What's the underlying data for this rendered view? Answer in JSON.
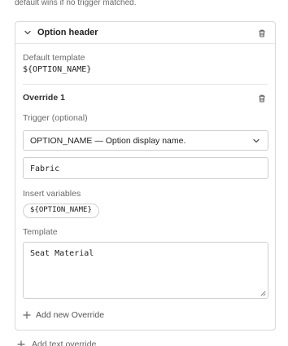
{
  "note": "default wins if no trigger matched.",
  "panel": {
    "title": "Option header",
    "default_label": "Default template",
    "default_value": "${OPTION_NAME}",
    "override": {
      "title": "Override 1",
      "trigger_label": "Trigger (optional)",
      "trigger_selected": "OPTION_NAME — Option display name.",
      "input_value": "Fabric",
      "insert_label": "Insert variables",
      "variable_chip": "${OPTION_NAME}",
      "template_label": "Template",
      "template_value": "Seat Material"
    },
    "add_override": "Add new Override"
  },
  "add_text_override": "Add text override",
  "icons": {
    "chevron": "chevron-down-icon",
    "trash": "trash-icon",
    "plus": "plus-icon",
    "resize": "resize-handle-icon"
  }
}
